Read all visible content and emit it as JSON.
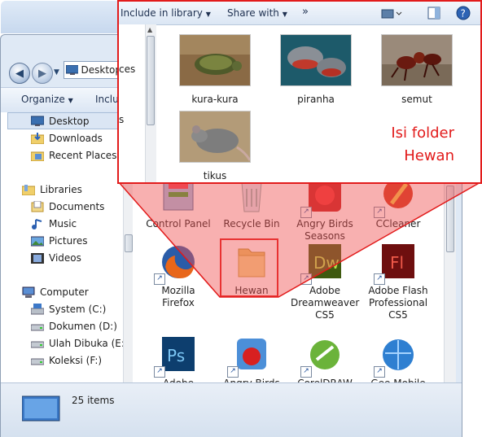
{
  "window": {
    "address": "Desktop",
    "toolbar": {
      "organize": "Organize",
      "include": "Inclu"
    },
    "nav": {
      "favorites": [
        {
          "label": "Desktop",
          "icon": "desktop-icon"
        },
        {
          "label": "Downloads",
          "icon": "downloads-icon"
        },
        {
          "label": "Recent Places",
          "icon": "recent-places-icon"
        }
      ],
      "libraries_label": "Libraries",
      "libraries": [
        {
          "label": "Documents",
          "icon": "documents-icon"
        },
        {
          "label": "Music",
          "icon": "music-icon"
        },
        {
          "label": "Pictures",
          "icon": "pictures-icon"
        },
        {
          "label": "Videos",
          "icon": "videos-icon"
        }
      ],
      "computer_label": "Computer",
      "drives": [
        {
          "label": "System (C:)"
        },
        {
          "label": "Dokumen (D:)"
        },
        {
          "label": "Ulah Dibuka (E:)"
        },
        {
          "label": "Koleksi (F:)"
        }
      ]
    },
    "items": [
      {
        "label": "Control Panel",
        "icon": "control-panel-icon"
      },
      {
        "label": "Recycle Bin",
        "icon": "recycle-bin-icon"
      },
      {
        "label": "Angry Birds Seasons",
        "icon": "angry-birds-seasons-icon"
      },
      {
        "label": "CCleaner",
        "icon": "ccleaner-icon"
      },
      {
        "label": "Mozilla Firefox",
        "icon": "firefox-icon"
      },
      {
        "label": "Hewan",
        "icon": "folder-icon"
      },
      {
        "label": "Adobe Dreamweaver CS5",
        "icon": "dreamweaver-icon"
      },
      {
        "label": "Adobe Flash Professional CS5",
        "icon": "flash-icon"
      },
      {
        "label": "Adobe",
        "icon": "photoshop-icon"
      },
      {
        "label": "Angry Birds",
        "icon": "angry-birds-icon"
      },
      {
        "label": "CorelDRAW",
        "icon": "coreldraw-icon"
      },
      {
        "label": "Gee Mobile",
        "icon": "gee-mobile-icon"
      }
    ],
    "status": "25 items"
  },
  "popup": {
    "toolbar": {
      "include": "Include in library",
      "share": "Share with",
      "more": "»"
    },
    "left_fragments": [
      "ces",
      "s"
    ],
    "files": [
      "kura-kura",
      "piranha",
      "semut",
      "tikus"
    ],
    "caption_line1": "Isi folder",
    "caption_line2": "Hewan"
  },
  "colors": {
    "highlight": "#e21b1b",
    "overlay": "rgba(240,80,80,0.45)"
  }
}
